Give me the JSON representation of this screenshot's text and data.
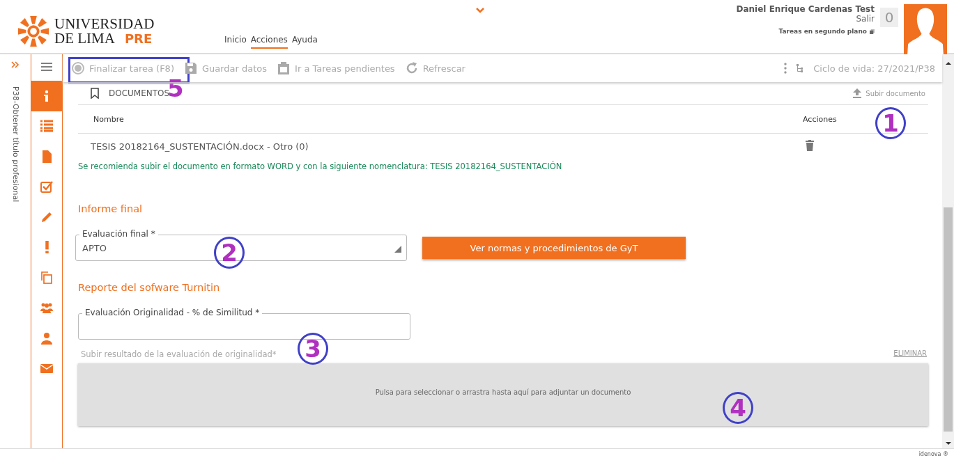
{
  "header": {
    "logo": {
      "line1": "UNIVERSIDAD",
      "line2": "DE LIMA",
      "badge": "PRE"
    },
    "nav": [
      {
        "label": "Inicio",
        "selected": false
      },
      {
        "label": "Acciones",
        "selected": true
      },
      {
        "label": "Ayuda",
        "selected": false
      }
    ],
    "user": {
      "name": "Daniel Enrique Cardenas Test",
      "logout": "Salir",
      "count": "0",
      "background_tasks": "Tareas en segundo plano"
    }
  },
  "side_tab": "P38-Obtener título profesional",
  "sidebar": {
    "items": [
      {
        "selected": true
      },
      {
        "selected": false
      },
      {
        "selected": false
      },
      {
        "selected": false
      },
      {
        "selected": false
      },
      {
        "selected": false
      },
      {
        "selected": false
      },
      {
        "selected": false
      },
      {
        "selected": false
      },
      {
        "selected": false
      }
    ]
  },
  "toolbar": {
    "buttons": [
      {
        "label": "Finalizar tarea (F8)"
      },
      {
        "label": "Guardar datos"
      },
      {
        "label": "Ir a Tareas pendientes"
      },
      {
        "label": "Refrescar"
      }
    ],
    "lifecycle": "Ciclo de vida: 27/2021/P38"
  },
  "documents": {
    "title": "DOCUMENTOS",
    "upload": "Subir documento",
    "columns": [
      "Nombre",
      "Acciones"
    ],
    "rows": [
      {
        "name": "TESIS 20182164_SUSTENTACIÓN.docx - Otro (0)"
      }
    ],
    "note": "Se recomienda subir el documento en formato WORD y con la siguiente nomenclatura: TESIS 20182164_SUSTENTACIÓN"
  },
  "final_report": {
    "title": "Informe final",
    "field_label": "Evaluación final *",
    "value": "APTO",
    "button": "Ver normas y procedimientos de GyT"
  },
  "turnitin": {
    "title": "Reporte del sofware Turnitin",
    "field_label": "Evaluación Originalidad - % de Similitud *",
    "upload_label": "Subir resultado de la evaluación de originalidad*",
    "delete": "ELIMINAR",
    "dropzone": "Pulsa para seleccionar o arrastra hasta aquí para adjuntar un documento"
  },
  "footer": "idenova ®",
  "annotations": [
    {
      "label": "1"
    },
    {
      "label": "2"
    },
    {
      "label": "3"
    },
    {
      "label": "4"
    },
    {
      "label": "5"
    }
  ]
}
